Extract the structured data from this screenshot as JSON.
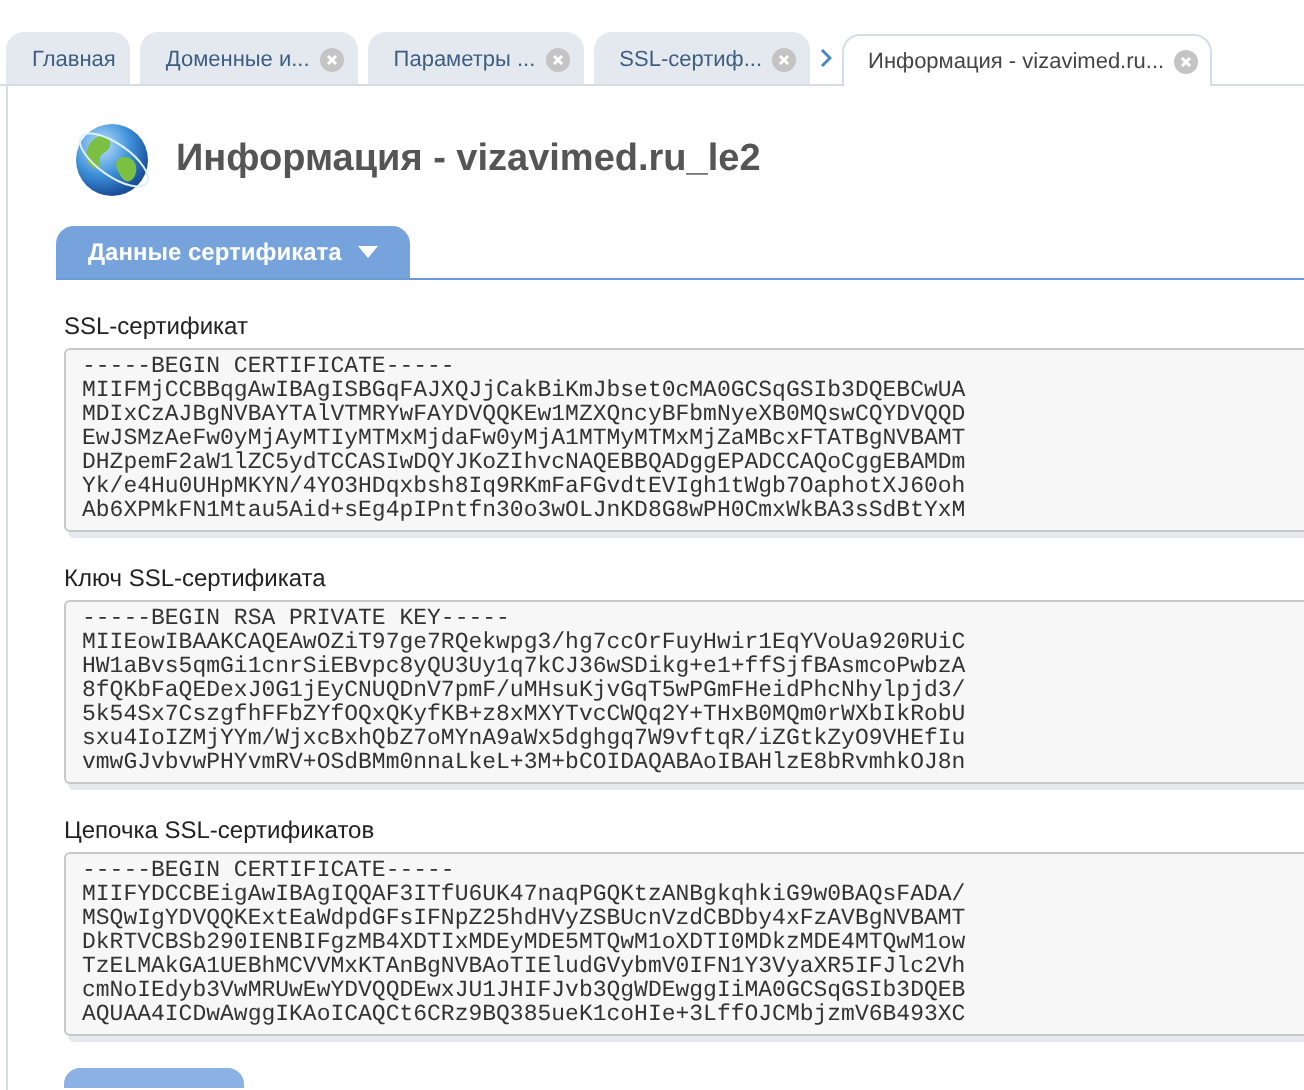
{
  "tabs": [
    {
      "label": "Главная",
      "closable": false,
      "selected": false
    },
    {
      "label": "Доменные и...",
      "closable": true,
      "selected": false
    },
    {
      "label": "Параметры ...",
      "closable": true,
      "selected": false
    },
    {
      "label": "SSL-сертиф...",
      "closable": true,
      "selected": false
    },
    {
      "label": "Информация - vizavimed.ru...",
      "closable": true,
      "selected": true
    }
  ],
  "page_title": "Информация - vizavimed.ru_le2",
  "section_tab": {
    "label": "Данные сертификата"
  },
  "fields": [
    {
      "label": "SSL-сертификат",
      "lines": [
        "-----BEGIN CERTIFICATE-----",
        "MIIFMjCCBBqgAwIBAgISBGqFAJXQJjCakBiKmJbset0cMA0GCSqGSIb3DQEBCwUA",
        "MDIxCzAJBgNVBAYTAlVTMRYwFAYDVQQKEw1MZXQncyBFbmNyeXB0MQswCQYDVQQD",
        "EwJSMzAeFw0yMjAyMTIyMTMxMjdaFw0yMjA1MTMyMTMxMjZaMBcxFTATBgNVBAMT",
        "DHZpemF2aW1lZC5ydTCCASIwDQYJKoZIhvcNAQEBBQADggEPADCCAQoCggEBAMDm",
        "Yk/e4Hu0UHpMKYN/4YO3HDqxbsh8Iq9RKmFaFGvdtEVIgh1tWgb7OaphotXJ60oh",
        "Ab6XPMkFN1Mtau5Aid+sEg4pIPntfn30o3wOLJnKD8G8wPH0CmxWkBA3sSdBtYxM"
      ]
    },
    {
      "label": "Ключ SSL-сертификата",
      "lines": [
        "-----BEGIN RSA PRIVATE KEY-----",
        "MIIEowIBAAKCAQEAwOZiT97ge7RQekwpg3/hg7ccOrFuyHwir1EqYVoUa920RUiC",
        "HW1aBvs5qmGi1cnrSiEBvpc8yQU3Uy1q7kCJ36wSDikg+e1+ffSjfBAsmcoPwbzA",
        "8fQKbFaQEDexJ0G1jEyCNUQDnV7pmF/uMHsuKjvGqT5wPGmFHeidPhcNhylpjd3/",
        "5k54Sx7CszgfhFFbZYfOQxQKyfKB+z8xMXYTvcCWQq2Y+THxB0MQm0rWXbIkRobU",
        "sxu4IoIZMjYYm/WjxcBxhQbZ7oMYnA9aWx5dghgq7W9vftqR/iZGtkZyO9VHEfIu",
        "vmwGJvbvwPHYvmRV+OSdBMm0nnaLkeL+3M+bCOIDAQABAoIBAHlzE8bRvmhkOJ8n"
      ]
    },
    {
      "label": "Цепочка SSL-сертификатов",
      "lines": [
        "-----BEGIN CERTIFICATE-----",
        "MIIFYDCCBEigAwIBAgIQQAF3ITfU6UK47naqPGQKtzANBgkqhkiG9w0BAQsFADA/",
        "MSQwIgYDVQQKExtEaWdpdGFsIFNpZ25hdHVyZSBUcnVzdCBDby4xFzAVBgNVBAMT",
        "DkRTVCBSb290IENBIFgzMB4XDTIxMDEyMDE5MTQwM1oXDTI0MDkzMDE4MTQwM1ow",
        "TzELMAkGA1UEBhMCVVMxKTAnBgNVBAoTIEludGVybmV0IFN1Y3VyaXR5IFJlc2Vh",
        "cmNoIEdyb3VwMRUwEwYDVQQDEwxJU1JHIFJvb3QgWDEwggIiMA0GCSqGSIb3DQEB",
        "AQUAA4ICDwAwggIKAoICAQCt6CRz9BQ385ueK1coHIe+3LffOJCMbjzmV6B493XC"
      ]
    }
  ]
}
